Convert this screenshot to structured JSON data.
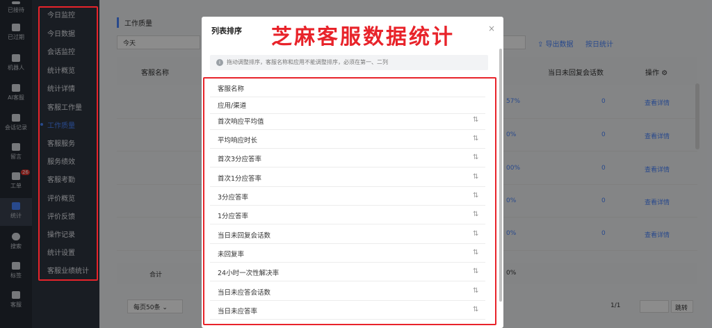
{
  "rail": {
    "items": [
      {
        "label": "已接待",
        "icon": "check-icon"
      },
      {
        "label": "已过期",
        "icon": "clock-icon"
      },
      {
        "label": "机器人",
        "icon": "robot-icon"
      },
      {
        "label": "AI客服",
        "icon": "chat-icon"
      },
      {
        "label": "会话记录",
        "icon": "message-icon"
      },
      {
        "label": "留言",
        "icon": "note-icon"
      },
      {
        "label": "工单",
        "icon": "ticket-icon",
        "badge": "26"
      },
      {
        "label": "统计",
        "icon": "chart-icon",
        "active": true
      },
      {
        "label": "搜索",
        "icon": "search-icon"
      },
      {
        "label": "标签",
        "icon": "tag-icon"
      },
      {
        "label": "客服",
        "icon": "agent-icon"
      }
    ]
  },
  "submenu": {
    "items": [
      "今日监控",
      "今日数据",
      "会话监控",
      "统计概览",
      "统计详情",
      "客服工作量",
      "工作质量",
      "客服服务",
      "服务绩效",
      "客服考勤",
      "评价概览",
      "评价反馈",
      "操作记录",
      "统计设置",
      "客服业绩统计"
    ],
    "active": "工作质量"
  },
  "main": {
    "section_title": "工作质量",
    "date_value": "今天",
    "export_label": "导出数据",
    "by_day_label": "按日统计",
    "headers": {
      "agent_name": "客服名称",
      "unreplied_today": "当日未回复会话数",
      "actions": "操作"
    },
    "rows": [
      {
        "pct": "57%",
        "unreplied": "0",
        "action": "查看详情"
      },
      {
        "pct": "0%",
        "unreplied": "0",
        "action": "查看详情"
      },
      {
        "pct": "00%",
        "unreplied": "0",
        "action": "查看详情"
      },
      {
        "pct": "0%",
        "unreplied": "0",
        "action": "查看详情"
      },
      {
        "pct": "0%",
        "unreplied": "0",
        "action": "查看详情"
      }
    ],
    "total_label": "合计",
    "total_pct": "0%",
    "page_size": "每页50条",
    "page_info": "1/1",
    "jump_label": "跳转"
  },
  "modal": {
    "title": "列表排序",
    "close": "×",
    "banner": "芝麻客服数据统计",
    "notice": "拖动调整排序，客服名称和应用不能调整排序，必须在第一、二列",
    "rows": [
      {
        "label": "客服名称",
        "sortable": false
      },
      {
        "label": "应用/渠道",
        "sortable": false
      },
      {
        "label": "首次响应平均值",
        "sortable": true
      },
      {
        "label": "平均响应时长",
        "sortable": true
      },
      {
        "label": "首次3分应答率",
        "sortable": true
      },
      {
        "label": "首次1分应答率",
        "sortable": true
      },
      {
        "label": "3分应答率",
        "sortable": true
      },
      {
        "label": "1分应答率",
        "sortable": true
      },
      {
        "label": "当日未回复会话数",
        "sortable": true
      },
      {
        "label": "未回复率",
        "sortable": true
      },
      {
        "label": "24小时一次性解决率",
        "sortable": true
      },
      {
        "label": "当日未应答会话数",
        "sortable": true
      },
      {
        "label": "当日未应答率",
        "sortable": true
      }
    ],
    "sort_glyph": "⇅"
  },
  "colors": {
    "accent": "#4a86ff",
    "annotation_red": "#e8232a",
    "badge_red": "#e8342f"
  }
}
